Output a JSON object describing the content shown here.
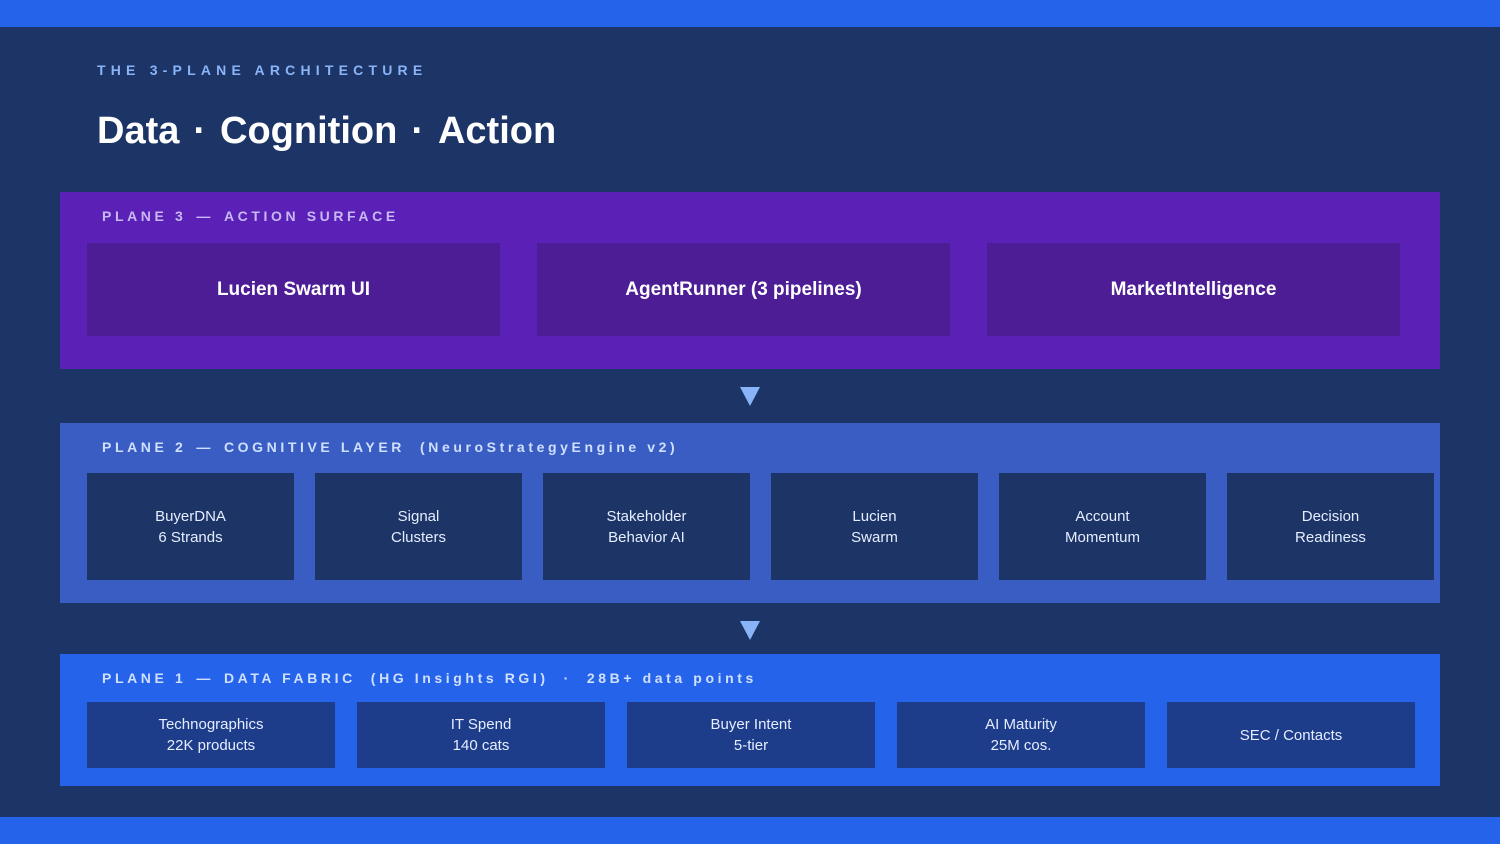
{
  "eyebrow": "THE 3-PLANE ARCHITECTURE",
  "title": {
    "part1": "Data",
    "sep": "·",
    "part2": "Cognition",
    "part3": "Action"
  },
  "plane3": {
    "label": "PLANE 3",
    "dash": "—",
    "name": "ACTION SURFACE",
    "items": [
      "Lucien Swarm UI",
      "AgentRunner (3 pipelines)",
      "MarketIntelligence"
    ]
  },
  "plane2": {
    "label": "PLANE 2",
    "dash": "—",
    "name": "COGNITIVE LAYER  (NeuroStrategyEngine v2)",
    "items": [
      {
        "line1": "BuyerDNA",
        "line2": "6 Strands"
      },
      {
        "line1": "Signal",
        "line2": "Clusters"
      },
      {
        "line1": "Stakeholder",
        "line2": "Behavior AI"
      },
      {
        "line1": "Lucien",
        "line2": "Swarm"
      },
      {
        "line1": "Account",
        "line2": "Momentum"
      },
      {
        "line1": "Decision",
        "line2": "Readiness"
      }
    ]
  },
  "plane1": {
    "label": "PLANE 1",
    "dash": "—",
    "name": "DATA FABRIC  (HG Insights RGI)  ·  28B+ data points",
    "items": [
      {
        "line1": "Technographics",
        "line2": "22K products"
      },
      {
        "line1": "IT Spend",
        "line2": "140 cats"
      },
      {
        "line1": "Buyer Intent",
        "line2": "5-tier"
      },
      {
        "line1": "AI Maturity",
        "line2": "25M cos."
      },
      {
        "line1": "SEC / Contacts",
        "line2": ""
      }
    ]
  },
  "colors": {
    "background": "#1c3566",
    "band": "#2563eb",
    "plane3": "#5b21b6",
    "plane2": "#3a5dc4",
    "plane1": "#2563eb",
    "accent": "#8ab4f8"
  },
  "icons": {
    "arrow": "down-triangle-icon"
  }
}
